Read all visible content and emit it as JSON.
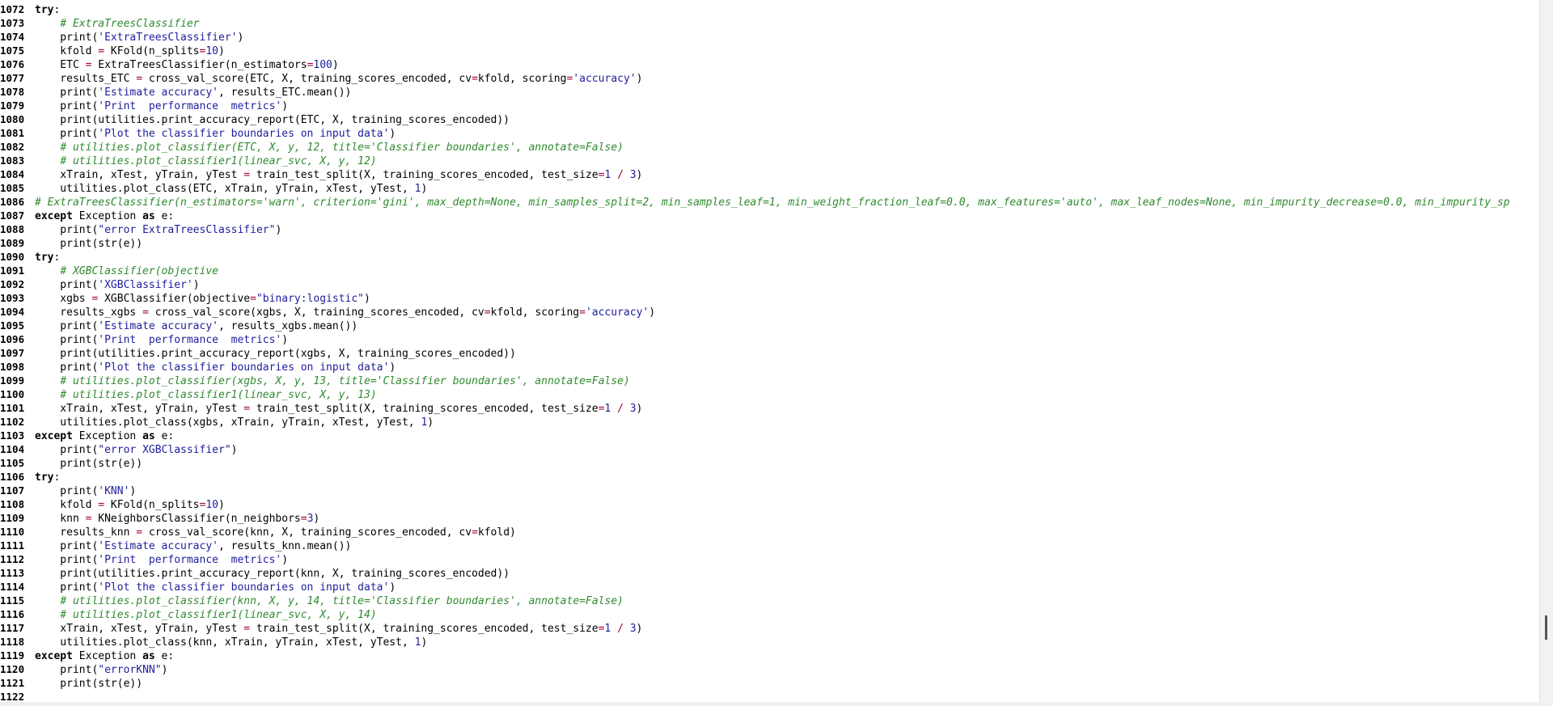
{
  "editor": {
    "lines": [
      {
        "n": "1072",
        "code": "try:"
      },
      {
        "n": "1073",
        "code": "    # ExtraTreesClassifier"
      },
      {
        "n": "1074",
        "code": "    print('ExtraTreesClassifier')"
      },
      {
        "n": "1075",
        "code": "    kfold = KFold(n_splits=10)"
      },
      {
        "n": "1076",
        "code": "    ETC = ExtraTreesClassifier(n_estimators=100)"
      },
      {
        "n": "1077",
        "code": "    results_ETC = cross_val_score(ETC, X, training_scores_encoded, cv=kfold, scoring='accuracy')"
      },
      {
        "n": "1078",
        "code": "    print('Estimate accuracy', results_ETC.mean())"
      },
      {
        "n": "1079",
        "code": "    print('Print  performance  metrics')"
      },
      {
        "n": "1080",
        "code": "    print(utilities.print_accuracy_report(ETC, X, training_scores_encoded))"
      },
      {
        "n": "1081",
        "code": "    print('Plot the classifier boundaries on input data')"
      },
      {
        "n": "1082",
        "code": "    # utilities.plot_classifier(ETC, X, y, 12, title='Classifier boundaries', annotate=False)"
      },
      {
        "n": "1083",
        "code": "    # utilities.plot_classifier1(linear_svc, X, y, 12)"
      },
      {
        "n": "1084",
        "code": "    xTrain, xTest, yTrain, yTest = train_test_split(X, training_scores_encoded, test_size=1 / 3)"
      },
      {
        "n": "1085",
        "code": "    utilities.plot_class(ETC, xTrain, yTrain, xTest, yTest, 1)"
      },
      {
        "n": "1086",
        "code": "# ExtraTreesClassifier(n_estimators='warn', criterion='gini', max_depth=None, min_samples_split=2, min_samples_leaf=1, min_weight_fraction_leaf=0.0, max_features='auto', max_leaf_nodes=None, min_impurity_decrease=0.0, min_impurity_sp"
      },
      {
        "n": "1087",
        "code": "except Exception as e:"
      },
      {
        "n": "1088",
        "code": "    print(\"error ExtraTreesClassifier\")"
      },
      {
        "n": "1089",
        "code": "    print(str(e))"
      },
      {
        "n": "1090",
        "code": "try:"
      },
      {
        "n": "1091",
        "code": "    # XGBClassifier(objective"
      },
      {
        "n": "1092",
        "code": "    print('XGBClassifier')"
      },
      {
        "n": "1093",
        "code": "    xgbs = XGBClassifier(objective=\"binary:logistic\")"
      },
      {
        "n": "1094",
        "code": "    results_xgbs = cross_val_score(xgbs, X, training_scores_encoded, cv=kfold, scoring='accuracy')"
      },
      {
        "n": "1095",
        "code": "    print('Estimate accuracy', results_xgbs.mean())"
      },
      {
        "n": "1096",
        "code": "    print('Print  performance  metrics')"
      },
      {
        "n": "1097",
        "code": "    print(utilities.print_accuracy_report(xgbs, X, training_scores_encoded))"
      },
      {
        "n": "1098",
        "code": "    print('Plot the classifier boundaries on input data')"
      },
      {
        "n": "1099",
        "code": "    # utilities.plot_classifier(xgbs, X, y, 13, title='Classifier boundaries', annotate=False)"
      },
      {
        "n": "1100",
        "code": "    # utilities.plot_classifier1(linear_svc, X, y, 13)"
      },
      {
        "n": "1101",
        "code": "    xTrain, xTest, yTrain, yTest = train_test_split(X, training_scores_encoded, test_size=1 / 3)"
      },
      {
        "n": "1102",
        "code": "    utilities.plot_class(xgbs, xTrain, yTrain, xTest, yTest, 1)"
      },
      {
        "n": "1103",
        "code": "except Exception as e:"
      },
      {
        "n": "1104",
        "code": "    print(\"error XGBClassifier\")"
      },
      {
        "n": "1105",
        "code": "    print(str(e))"
      },
      {
        "n": "1106",
        "code": "try:"
      },
      {
        "n": "1107",
        "code": "    print('KNN')"
      },
      {
        "n": "1108",
        "code": "    kfold = KFold(n_splits=10)"
      },
      {
        "n": "1109",
        "code": "    knn = KNeighborsClassifier(n_neighbors=3)"
      },
      {
        "n": "1110",
        "code": "    results_knn = cross_val_score(knn, X, training_scores_encoded, cv=kfold)"
      },
      {
        "n": "1111",
        "code": "    print('Estimate accuracy', results_knn.mean())"
      },
      {
        "n": "1112",
        "code": "    print('Print  performance  metrics')"
      },
      {
        "n": "1113",
        "code": "    print(utilities.print_accuracy_report(knn, X, training_scores_encoded))"
      },
      {
        "n": "1114",
        "code": "    print('Plot the classifier boundaries on input data')"
      },
      {
        "n": "1115",
        "code": "    # utilities.plot_classifier(knn, X, y, 14, title='Classifier boundaries', annotate=False)"
      },
      {
        "n": "1116",
        "code": "    # utilities.plot_classifier1(linear_svc, X, y, 14)"
      },
      {
        "n": "1117",
        "code": "    xTrain, xTest, yTrain, yTest = train_test_split(X, training_scores_encoded, test_size=1 / 3)"
      },
      {
        "n": "1118",
        "code": "    utilities.plot_class(knn, xTrain, yTrain, xTest, yTest, 1)"
      },
      {
        "n": "1119",
        "code": "except Exception as e:"
      },
      {
        "n": "1120",
        "code": "    print(\"errorKNN\")"
      },
      {
        "n": "1121",
        "code": "    print(str(e))"
      },
      {
        "n": "1122",
        "code": ""
      }
    ]
  }
}
